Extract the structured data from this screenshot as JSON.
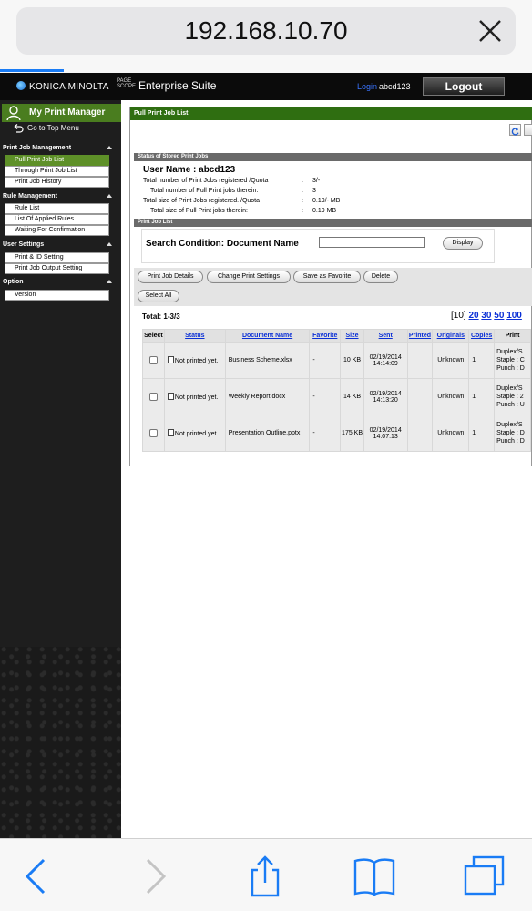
{
  "browser": {
    "address": "192.168.10.70"
  },
  "header": {
    "brand": "KONICA MINOLTA",
    "suite_small": "PAGE SCOPE",
    "suite": "Enterprise Suite",
    "login_label": "Login",
    "login_user": "abcd123",
    "logout": "Logout"
  },
  "sidebar": {
    "title": "My Print Manager",
    "go_top": "Go to Top Menu",
    "sections": [
      {
        "heading": "Print Job Management",
        "items": [
          "Pull Print Job List",
          "Through Print Job List",
          "Print Job History"
        ]
      },
      {
        "heading": "Rule Management",
        "items": [
          "Rule List",
          "List Of Applied Rules",
          "Waiting For Confirmation"
        ]
      },
      {
        "heading": "User Settings",
        "items": [
          "Print & ID Setting",
          "Print Job Output Setting"
        ]
      },
      {
        "heading": "Option",
        "items": [
          "Version"
        ]
      }
    ]
  },
  "main": {
    "panel_title": "Pull Print Job List",
    "status_heading": "Status of Stored Print Jobs",
    "user_name": "User Name : abcd123",
    "status_rows": [
      {
        "label": "Total number of Print Jobs registered /Quota",
        "value": "3/-"
      },
      {
        "label": "Total number of Pull Print jobs therein:",
        "value": "3"
      },
      {
        "label": "Total size of Print Jobs registered. /Quota",
        "value": "0.19/- MB"
      },
      {
        "label": "Total size of Pull Print jobs therein:",
        "value": "0.19 MB"
      }
    ],
    "colon": ":",
    "list_heading": "Print Job List",
    "search_label": "Search Condition:   Document Name",
    "display_button": "Display",
    "buttons": {
      "details": "Print Job Details",
      "change": "Change Print Settings",
      "favorite": "Save as Favorite",
      "delete": "Delete",
      "select_all": "Select All"
    },
    "total": "Total:   1-3/3",
    "pager": {
      "current": "[10]",
      "links": [
        "20",
        "30",
        "50",
        "100"
      ]
    },
    "columns": [
      "Select",
      "Status",
      "Document Name",
      "Favorite",
      "Size",
      "Sent",
      "Printed",
      "Originals",
      "Copies",
      "Print"
    ],
    "rows": [
      {
        "status": "Not printed yet.",
        "document": "Business Scheme.xlsx",
        "favorite": "-",
        "size": "10 KB",
        "sent_date": "02/19/2014",
        "sent_time": "14:14:09",
        "printed": "",
        "originals": "Unknown",
        "copies": "1",
        "print_lines": [
          "Duplex/S",
          "Staple : C",
          "Punch : D"
        ]
      },
      {
        "status": "Not printed yet.",
        "document": "Weekly Report.docx",
        "favorite": "-",
        "size": "14 KB",
        "sent_date": "02/19/2014",
        "sent_time": "14:13:20",
        "printed": "",
        "originals": "Unknown",
        "copies": "1",
        "print_lines": [
          "Duplex/S",
          "Staple : 2",
          "Punch : U"
        ]
      },
      {
        "status": "Not printed yet.",
        "document": "Presentation Outline.pptx",
        "favorite": "-",
        "size": "175 KB",
        "sent_date": "02/19/2014",
        "sent_time": "14:07:13",
        "printed": "",
        "originals": "Unknown",
        "copies": "1",
        "print_lines": [
          "Duplex/S",
          "Staple : D",
          "Punch : D"
        ]
      }
    ]
  },
  "colors": {
    "green": "#2f6e11",
    "sidebar_active": "#5e9028",
    "link_blue": "#0a2fd6",
    "safari_blue": "#1a7cf5"
  }
}
